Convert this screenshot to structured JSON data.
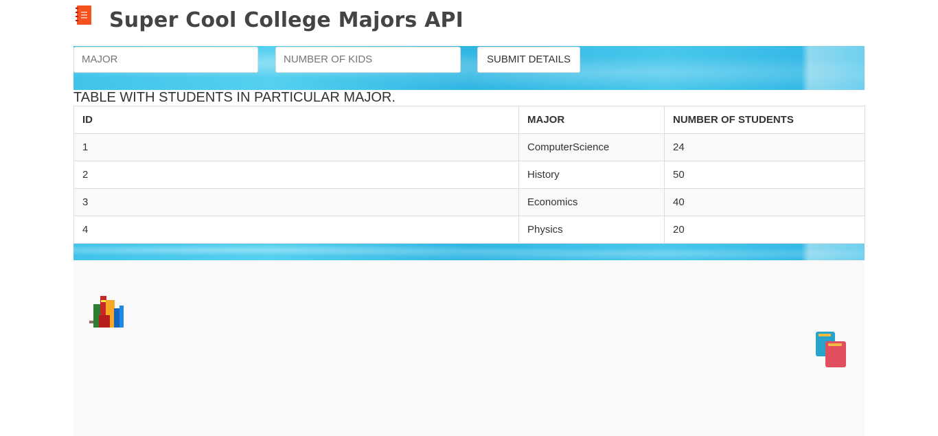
{
  "header": {
    "title": "Super Cool College Majors API",
    "logo_icon": "notebook-icon"
  },
  "form": {
    "major_placeholder": "MAJOR",
    "major_value": "",
    "kids_placeholder": "NUMBER OF KIDS",
    "kids_value": "",
    "submit_label": "SUBMIT DETAILS"
  },
  "table": {
    "caption": "TABLE WITH STUDENTS IN PARTICULAR MAJOR.",
    "headers": [
      "ID",
      "MAJOR",
      "NUMBER OF STUDENTS"
    ],
    "rows": [
      [
        "1",
        "ComputerScience",
        "24"
      ],
      [
        "2",
        "History",
        "50"
      ],
      [
        "3",
        "Economics",
        "40"
      ],
      [
        "4",
        "Physics",
        "20"
      ]
    ]
  },
  "icons": {
    "left": "bookshelf-icon",
    "right": "books-icon"
  },
  "colors": {
    "water_accent": "#3fc3ea",
    "logo": "#f4511e"
  }
}
